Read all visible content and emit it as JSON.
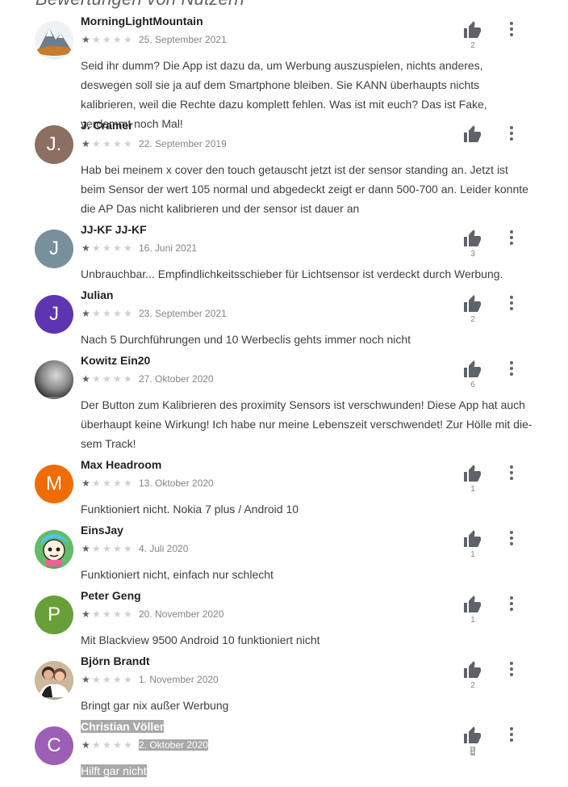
{
  "section_title": "Bewertungen von Nutzern",
  "reviews": [
    {
      "name": "MorningLightMountain",
      "rating": 1,
      "date": "25. September 2021",
      "text": "Seid ihr dumm? Die App ist dazu da, um Werbung auszuspielen, nichts anderes, deswegen soll sie ja auf dem Smartphone bleiben. Sie KANN überhaupts nichts kalibrieren, weil die Rechte dazu komplett fehlen. Was ist mit euch? Das ist Fake, verdammt noch Mal!",
      "helpful_count": "2",
      "avatar_letter": "",
      "avatar_color": "#e8eef2",
      "avatar_icon": "mountain-avatar-icon"
    },
    {
      "name": "J. Cramer",
      "rating": 1,
      "date": "22. September 2019",
      "text": "Hab bei meinem x cover den touch getauscht jetzt ist der sensor standing an. Jetzt ist beim Sensor der wert 105 normal und abgedeckt zeigt er dann 500-700 an. Leider konnte die AP Das nicht kalibrieren und der sensor ist dauer an",
      "helpful_count": "",
      "avatar_letter": "J.",
      "avatar_color": "#8d6e63",
      "avatar_icon": ""
    },
    {
      "name": "JJ-KF JJ-KF",
      "rating": 1,
      "date": "16. Juni 2021",
      "text": "Unbrauchbar... Empfindlichkeitsschieber für Lichtsensor ist verdeckt durch Werbung.",
      "helpful_count": "3",
      "avatar_letter": "J",
      "avatar_color": "#78909c",
      "avatar_icon": ""
    },
    {
      "name": "Julian",
      "rating": 1,
      "date": "23. September 2021",
      "text": "Nach 5 Durchführungen und 10 Werbeclis gehts immer noch nicht",
      "helpful_count": "2",
      "avatar_letter": "J",
      "avatar_color": "#5e35b1",
      "avatar_icon": ""
    },
    {
      "name": "Kowitz Ein20",
      "rating": 1,
      "date": "27. Oktober 2020",
      "text": "Der Button zum Kalibrieren des proximity Sensors ist verschwunden! Diese App hat auch überhaupt keine Wirkung! Ich habe nur meine Lebenszeit verschwendet! Zur Hölle mit die­sem Track!",
      "helpful_count": "6",
      "avatar_letter": "",
      "avatar_color": "#707070",
      "avatar_icon": "blurred-photo-avatar-icon"
    },
    {
      "name": "Max Headroom",
      "rating": 1,
      "date": "13. Oktober 2020",
      "text": "Funktioniert nicht. Nokia 7 plus / Android 10",
      "helpful_count": "1",
      "avatar_letter": "M",
      "avatar_color": "#ef6c00",
      "avatar_icon": ""
    },
    {
      "name": "EinsJay",
      "rating": 1,
      "date": "4. Juli 2020",
      "text": "Funktioniert nicht, einfach nur schlecht",
      "helpful_count": "1",
      "avatar_letter": "",
      "avatar_color": "#4caf50",
      "avatar_icon": "cartoon-face-avatar-icon"
    },
    {
      "name": "Peter Geng",
      "rating": 1,
      "date": "20. November 2020",
      "text": "Mit Blackview 9500 Android 10 funktioniert nicht",
      "helpful_count": "1",
      "avatar_letter": "P",
      "avatar_color": "#689f38",
      "avatar_icon": ""
    },
    {
      "name": "Björn Brandt",
      "rating": 1,
      "date": "1. November 2020",
      "text": "Bringt gar nix außer Werbung",
      "helpful_count": "2",
      "avatar_letter": "",
      "avatar_color": "#b0a090",
      "avatar_icon": "couple-photo-avatar-icon"
    },
    {
      "name": "Christian Völler",
      "rating": 1,
      "date": "2. Oktober 2020",
      "text": "Hilft gar nicht",
      "helpful_count": "1",
      "avatar_letter": "C",
      "avatar_color": "#9c5fb5",
      "avatar_icon": "",
      "highlighted": true
    }
  ],
  "colors": {
    "star_filled": "#5f6368",
    "star_empty": "#d0d0d0",
    "highlight": "#a9a9a9"
  },
  "icons": {
    "thumb": "thumbs-up-icon",
    "more": "more-vert-icon"
  }
}
